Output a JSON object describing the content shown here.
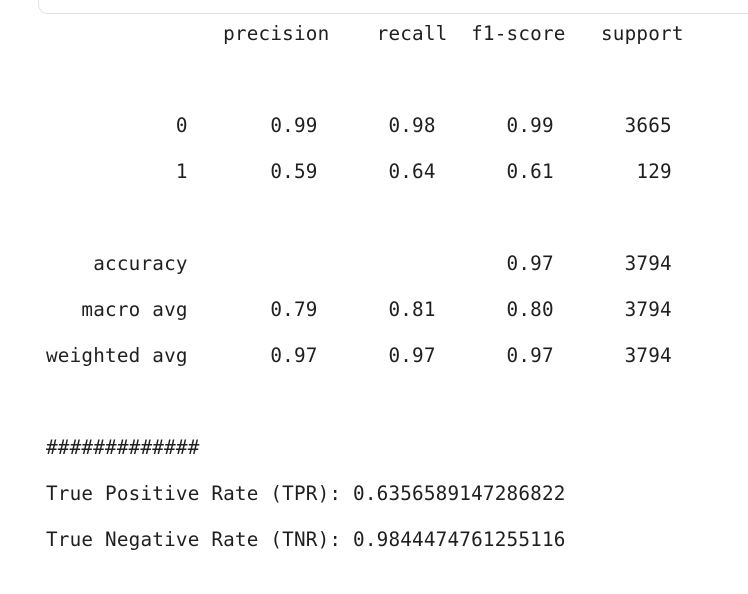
{
  "report": {
    "lines": [
      "               precision    recall  f1-score   support",
      "",
      "",
      "           0       0.99      0.98      0.99      3665",
      "           1       0.59      0.64      0.61       129",
      "",
      "",
      "    accuracy                           0.97      3794",
      "   macro avg       0.79      0.81      0.80      3794",
      "weighted avg       0.97      0.97      0.97      3794",
      "",
      "",
      "#############",
      "True Positive Rate (TPR): 0.6356589147286822",
      "True Negative Rate (TNR): 0.9844474761255116"
    ]
  }
}
